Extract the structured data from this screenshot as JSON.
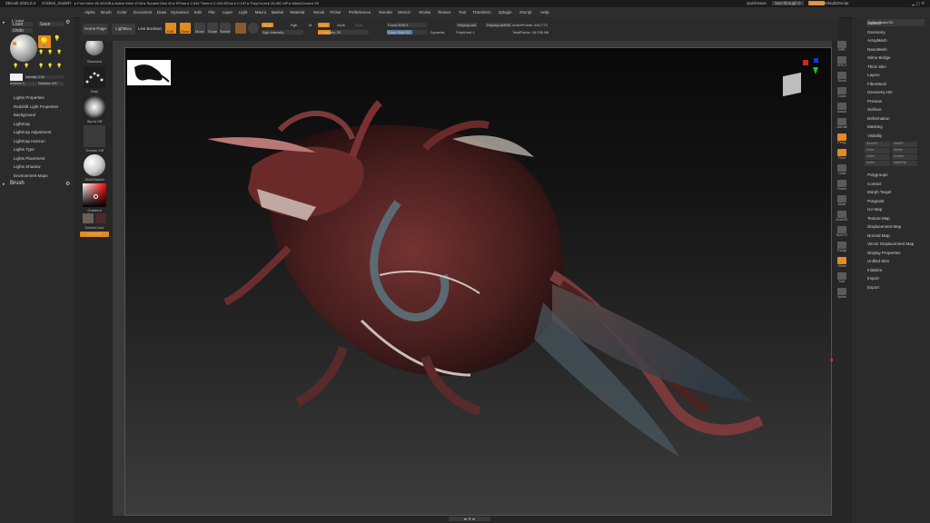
{
  "titlebar": {
    "app": "ZBrush 2024.0.4",
    "file": "chicken_model?",
    "stats": "▸ Free Mem 65.352GB ▸ Active Mem 6718 ▸ Scratch Disk 40 ▸ RTime ▸ 2.642 Timer ▸ 2.349 ATime ▸ 0.197 ▸ PolyCount ▸ 26.962 MP ▸ MeshCount ▸ 59",
    "quicksave": "QuickSave",
    "seethrough": "See-through 0",
    "menus_btn": "Menus",
    "script": "DefaultZScript"
  },
  "menubar": [
    "Alpha",
    "Brush",
    "Color",
    "Document",
    "Draw",
    "Dynamics",
    "Edit",
    "File",
    "Layer",
    "Light",
    "Macro",
    "Marker",
    "Material",
    "Movie",
    "Picker",
    "Preferences",
    "Render",
    "Stencil",
    "Stroke",
    "Texture",
    "Tool",
    "Transform",
    "Zplugin",
    "Zscript",
    "Help"
  ],
  "leftpanel": {
    "title": "Light",
    "load": "Load",
    "save": "Save",
    "undo": "Undo",
    "intensity": "Intensity 0.84",
    "ambient": "Ambient 3",
    "distance": "Distance 100",
    "items": [
      "Lights Properties",
      "Redshift Light Properties",
      "Background",
      "LightCap",
      "LightCap Adjustment",
      "LightCap Horizon",
      "Lights Type",
      "Lights Placement",
      "Lights Shadow",
      "Environment Maps"
    ],
    "brush": "Brush"
  },
  "shelf": {
    "standard": "Standard",
    "dots": "Dots",
    "alpha": "Alpha Off",
    "texture": "Texture Off",
    "material": "SkinShade4",
    "gradient": "Gradient",
    "switchcolor": "SwitchColor",
    "alternate": "Alternate"
  },
  "toolbar": {
    "homepage": "Home Page",
    "lightbox": "LightBox",
    "liveboolean": "Live Boolean",
    "edit": "Edit",
    "draw": "Draw",
    "move": "Move",
    "scale": "Scale",
    "rotate": "Rotate",
    "mrgb": "Mrgb",
    "rgb": "Rgb",
    "m": "M",
    "zadd": "Zadd",
    "zsub": "Zsub",
    "zcut": "Zcut",
    "rgb_intensity": "Rgb Intensity",
    "z_intensity": "Z Intensity 25",
    "focal_shift": "Focal Shift 0",
    "draw_size": "Draw Size 64",
    "dynamic": "Dynamic",
    "replaylast": "ReplayLast",
    "replaylastrel": "ReplayLastRel",
    "active_points": "ActivePoints: 844,773",
    "total_points": "TotalPoints: 16.039 Mil",
    "pfsm": "PolyfLimit 1"
  },
  "rightstrip": [
    "BPR",
    "SPix 3",
    "Scroll",
    "Zoom",
    "Actual",
    "AAHalf",
    "Persp",
    "Floor",
    "Local",
    "Frame",
    "Move",
    "Zoom3D",
    "RotXYZ",
    "Transp",
    "Ghost",
    "Solo",
    "Xpose"
  ],
  "rightpanel": {
    "header": "SplineSnake3D",
    "items": [
      "Subtool",
      "Geometry",
      "ArrayMesh",
      "NanoMesh",
      "Slime Bridge",
      "Thick Skin",
      "Layers",
      "FiberMesh",
      "Geometry HD",
      "Preview",
      "Surface",
      "Deformation",
      "Masking",
      "Visibility"
    ],
    "vis_buttons": [
      "ShowPt",
      "HidePt",
      "Grow",
      "Shrink",
      "Outer",
      "Unhide",
      "Invert",
      "HidePoly"
    ],
    "items2": [
      "Polygroups",
      "Contact",
      "Morph Target",
      "Polypaint",
      "UV Map",
      "Texture Map",
      "Displacement Map",
      "Normal Map",
      "Vector Displacement Map",
      "Display Properties",
      "Unified Skin",
      "Initialize",
      "Import",
      "Export"
    ]
  },
  "colors": {
    "accent": "#e58a1f",
    "panel": "#2b2b2b",
    "bg": "#262626"
  }
}
